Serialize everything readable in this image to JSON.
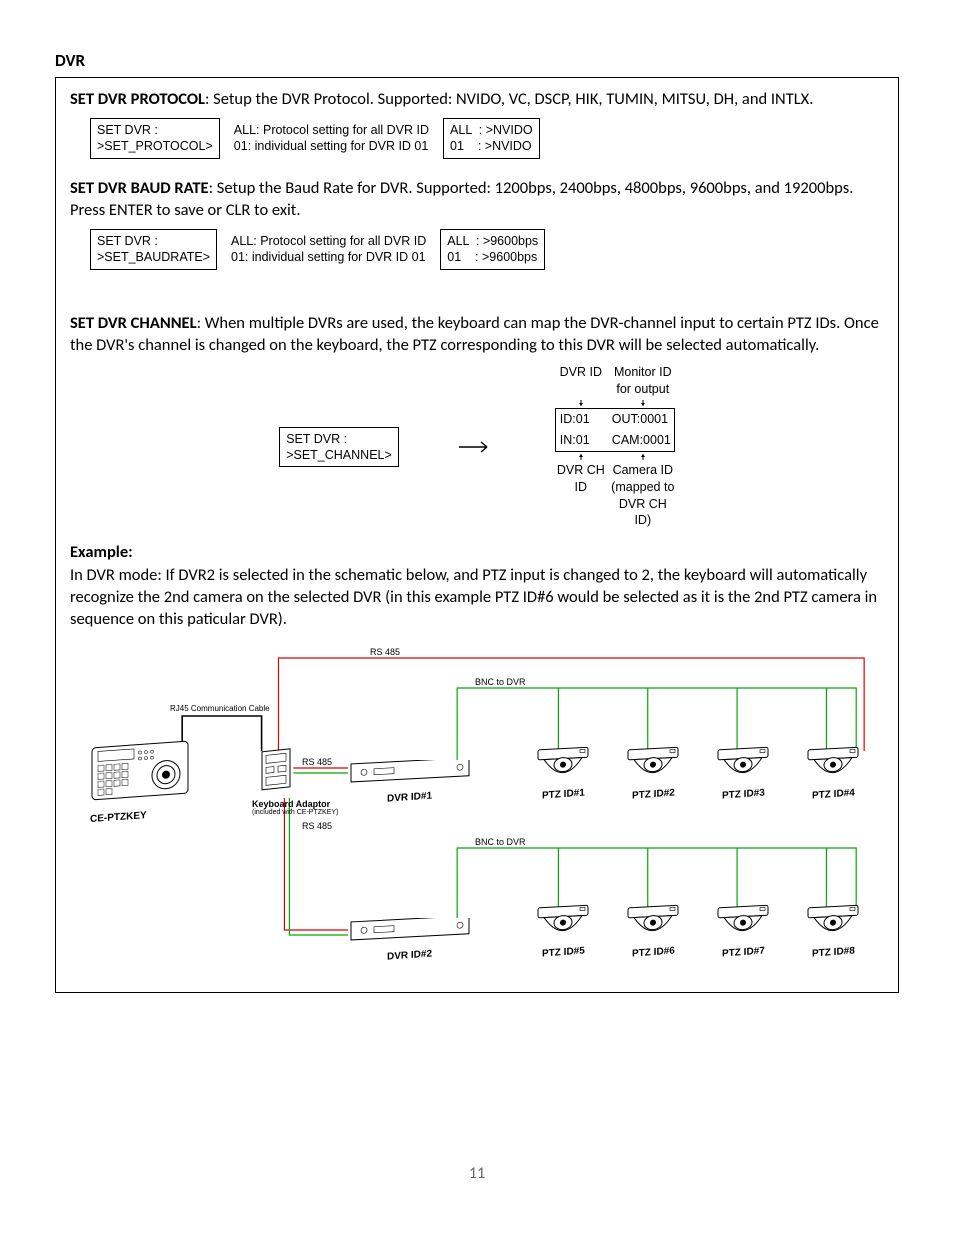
{
  "page_number": "11",
  "section_heading": "DVR",
  "protocol": {
    "heading": "SET DVR PROTOCOL",
    "text": ": Setup the DVR Protocol. Supported: NVIDO, VC, DSCP, HIK, TUMIN, MITSU, DH, and INTLX.",
    "lcd1": "SET DVR :\n>SET_PROTOCOL>",
    "note": "ALL: Protocol setting for all DVR ID\n01: individual setting for DVR ID 01",
    "lcd2": "ALL  : >NVIDO\n01    : >NVIDO"
  },
  "baud": {
    "heading": "SET DVR BAUD RATE",
    "text": ": Setup the Baud Rate for DVR. Supported: 1200bps, 2400bps, 4800bps, 9600bps, and 19200bps. Press ENTER to save or CLR to exit.",
    "lcd1": "SET DVR :\n>SET_BAUDRATE>",
    "note": "ALL: Protocol setting for all DVR ID\n01: individual setting for DVR ID 01",
    "lcd2": "ALL  : >9600bps\n01    : >9600bps"
  },
  "channel": {
    "heading": "SET DVR CHANNEL",
    "text": ": When multiple DVRs are used, the keyboard can map the DVR-channel input to certain PTZ IDs. Once the DVR's channel is changed on the keyboard, the PTZ corresponding to this DVR will be selected automatically.",
    "lcd": "SET DVR :\n>SET_CHANNEL>",
    "labels_top": {
      "l": "DVR ID",
      "r": "Monitor ID for output"
    },
    "grid": {
      "a": "ID:01",
      "b": "OUT:0001",
      "c": "IN:01",
      "d": "CAM:0001"
    },
    "labels_bottom": {
      "l": "DVR CH ID",
      "r": "Camera ID\n(mapped to DVR CH ID)"
    }
  },
  "example": {
    "heading": "Example:",
    "text": "In DVR mode: If DVR2 is selected in the schematic below, and PTZ input is changed to 2, the keyboard will automatically recognize the 2nd camera on the selected DVR (in this example PTZ ID#6 would be selected as it is the 2nd PTZ camera in sequence on this paticular DVR)."
  },
  "diagram": {
    "rs485_top": "RS 485",
    "rs485_left1": "RS 485",
    "rs485_left2": "RS 485",
    "bnc1": "BNC to DVR",
    "bnc2": "BNC to DVR",
    "rj45": "RJ45 Communication Cable",
    "keyboard_adaptor": "Keyboard Adaptor",
    "keyboard_adaptor_sub": "(included with CE-PTZKEY)",
    "keyboard_label": "CE-PTZKEY",
    "dvr1": "DVR ID#1",
    "dvr2": "DVR ID#2",
    "ptz": [
      "PTZ ID#1",
      "PTZ ID#2",
      "PTZ ID#3",
      "PTZ ID#4",
      "PTZ ID#5",
      "PTZ ID#6",
      "PTZ ID#7",
      "PTZ ID#8"
    ]
  }
}
